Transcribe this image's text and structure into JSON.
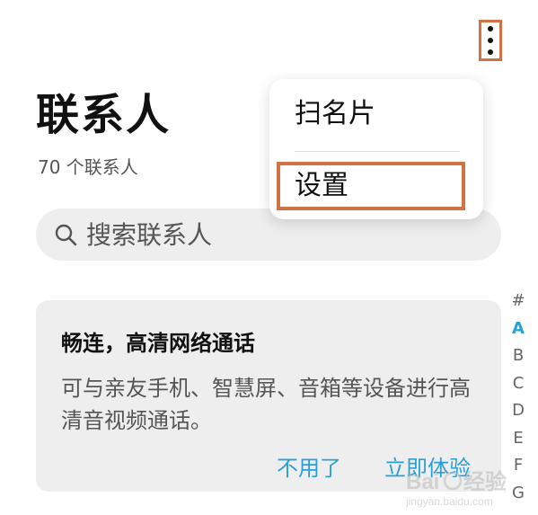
{
  "header": {
    "more_icon": "more-vertical-icon",
    "title": "联系人",
    "contact_count": "70 个联系人"
  },
  "popup_menu": {
    "items": [
      {
        "label": "扫名片"
      },
      {
        "label": "设置",
        "highlighted": true
      }
    ],
    "highlight_color": "#d07244"
  },
  "search": {
    "icon": "search-icon",
    "placeholder": "搜索联系人",
    "value": ""
  },
  "promo": {
    "title": "畅连，高清网络通话",
    "description": "可与亲友手机、智慧屏、音箱等设备进行高清音视频通话。",
    "dismiss_label": "不用了",
    "try_label": "立即体验",
    "accent_color": "#2a9fd8"
  },
  "alpha_index": {
    "letters": [
      "#",
      "A",
      "B",
      "C",
      "D",
      "E",
      "F",
      "G"
    ],
    "active": "A"
  },
  "watermark": {
    "text": "Baidu 经验",
    "url": "jingyan.baidu.com"
  }
}
